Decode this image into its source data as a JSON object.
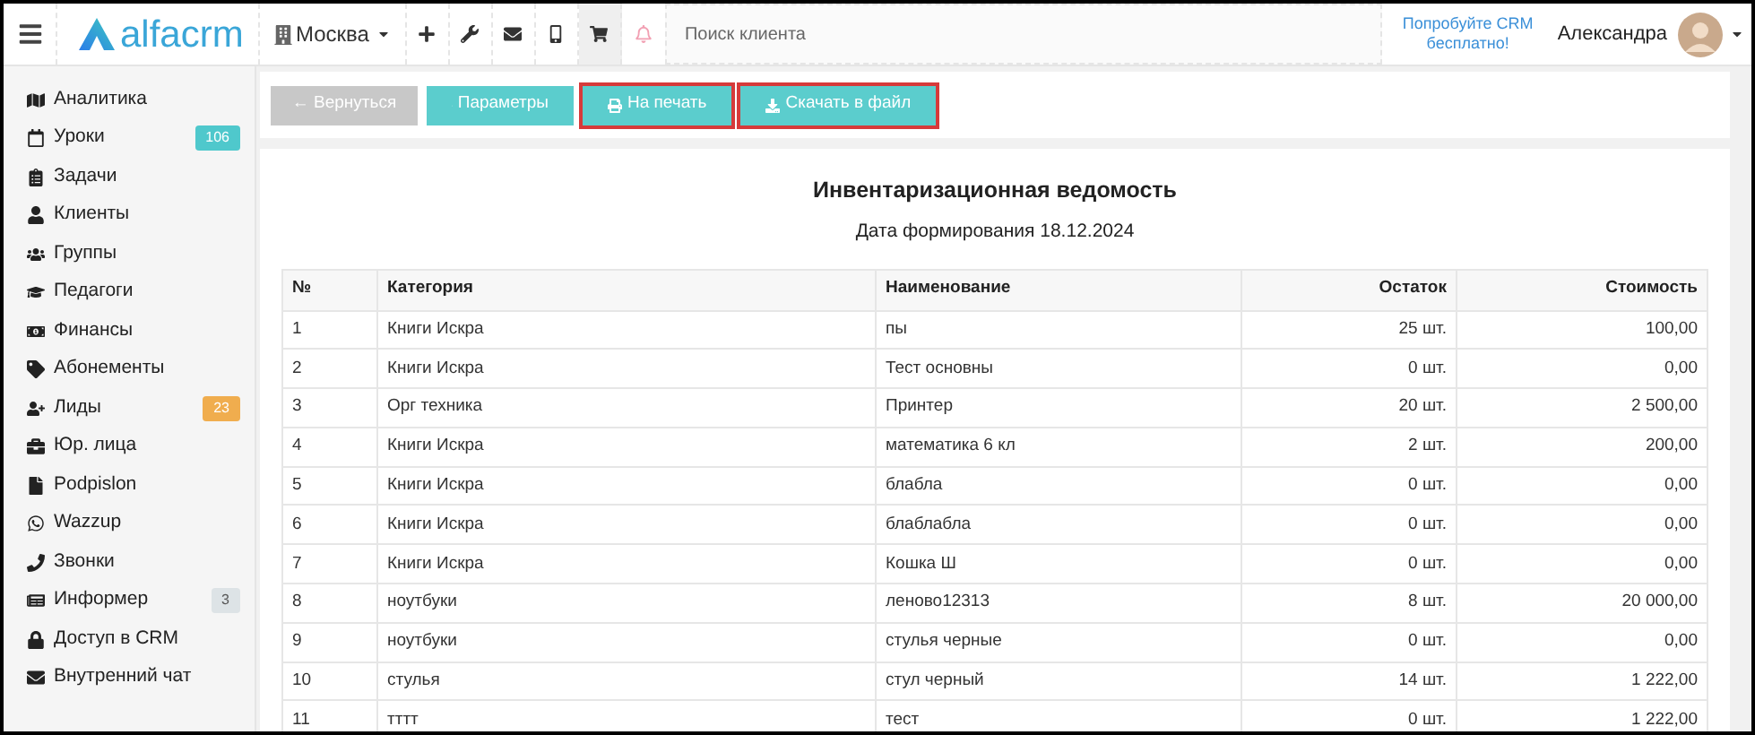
{
  "header": {
    "logo": "alfacrm",
    "branch": "Москва",
    "toolbar_icons": [
      {
        "selected": false
      },
      {
        "selected": false
      },
      {
        "selected": false
      },
      {
        "selected": false
      },
      {
        "selected": true
      },
      {
        "selected": false
      }
    ],
    "search": {
      "placeholder": "Поиск клиента"
    },
    "promo": "Попробуйте CRM бесплатно!",
    "user": "Александра"
  },
  "sidebar": {
    "items": [
      {
        "label": "Аналитика"
      },
      {
        "label": "Уроки",
        "badge": {
          "text": "106",
          "color": "#4fc8cc"
        }
      },
      {
        "label": "Задачи"
      },
      {
        "label": "Клиенты"
      },
      {
        "label": "Группы"
      },
      {
        "label": "Педагоги"
      },
      {
        "label": "Финансы"
      },
      {
        "label": "Абонементы"
      },
      {
        "label": "Лиды",
        "badge": {
          "text": "23",
          "color": "#f0ad4e"
        }
      },
      {
        "label": "Юр. лица"
      },
      {
        "label": "Podpislon"
      },
      {
        "label": "Wazzup"
      },
      {
        "label": "Звонки"
      },
      {
        "label": "Информер",
        "badge": {
          "text": "3",
          "color": "#dde3e6"
        }
      },
      {
        "label": "Доступ в CRM"
      },
      {
        "label": "Внутренний чат"
      }
    ]
  },
  "actions": [
    {
      "label": "← Вернуться",
      "disabled": true,
      "highlighted": false
    },
    {
      "label": "Параметры",
      "disabled": false,
      "highlighted": false
    },
    {
      "label": "На печать",
      "disabled": false,
      "highlighted": true
    },
    {
      "label": "Скачать в файл",
      "disabled": false,
      "highlighted": true
    }
  ],
  "report": {
    "title": "Инвентаризационная ведомость",
    "subtitle": "Дата формирования 18.12.2024",
    "table": {
      "columns": [
        "№",
        "Категория",
        "Наименование",
        "Остаток",
        "Стоимость"
      ],
      "rows": [
        [
          "1",
          "Книги Искра",
          "пы",
          "25 шт.",
          "100,00"
        ],
        [
          "2",
          "Книги Искра",
          "Тест основны",
          "0 шт.",
          "0,00"
        ],
        [
          "3",
          "Орг техника",
          "Принтер",
          "20 шт.",
          "2 500,00"
        ],
        [
          "4",
          "Книги Искра",
          "математика 6 кл",
          "2 шт.",
          "200,00"
        ],
        [
          "5",
          "Книги Искра",
          "блабла",
          "0 шт.",
          "0,00"
        ],
        [
          "6",
          "Книги Искра",
          "блаблабла",
          "0 шт.",
          "0,00"
        ],
        [
          "7",
          "Книги Искра",
          "Кошка Ш",
          "0 шт.",
          "0,00"
        ],
        [
          "8",
          "ноутбуки",
          "леново12313",
          "8 шт.",
          "20 000,00"
        ],
        [
          "9",
          "ноутбуки",
          "стулья черные",
          "0 шт.",
          "0,00"
        ],
        [
          "10",
          "стулья",
          "стул черный",
          "14 шт.",
          "1 222,00"
        ],
        [
          "11",
          "тттт",
          "тест",
          "0 шт.",
          "1 222,00"
        ]
      ]
    }
  }
}
